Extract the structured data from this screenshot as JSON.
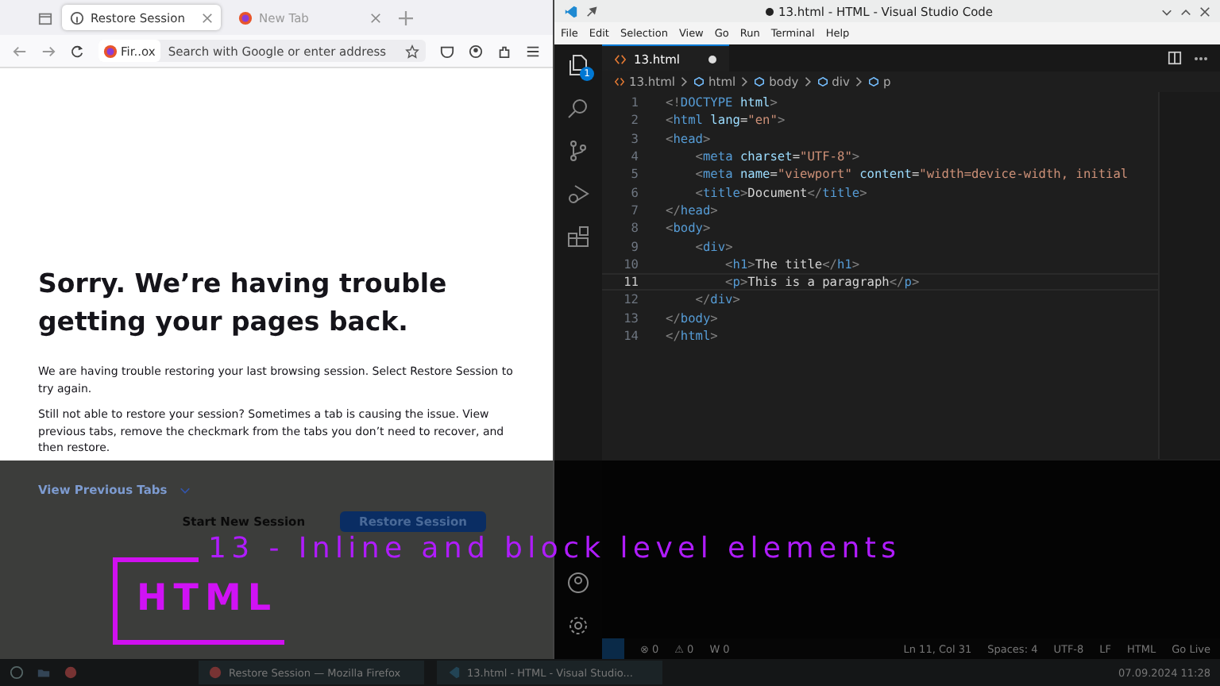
{
  "browser": {
    "tabs": [
      {
        "label": "Restore Session",
        "selected": true,
        "kind": "info"
      },
      {
        "label": "New Tab",
        "selected": false,
        "kind": "firefox"
      }
    ],
    "identity": "Fir..ox",
    "address_placeholder": "Search with Google or enter address",
    "heading": "Sorry. We’re having trouble getting your pages back.",
    "paragraphs": [
      "We are having trouble restoring your last browsing session. Select Restore Session to try again.",
      "Still not able to restore your session? Sometimes a tab is causing the issue. View previous tabs, remove the checkmark from the tabs you don’t need to recover, and then restore."
    ],
    "view_previous": "View Previous Tabs",
    "buttons": [
      {
        "label": "Start New Session",
        "kind": "plain"
      },
      {
        "label": "Restore Session",
        "kind": "primary"
      }
    ]
  },
  "editor": {
    "title": "13.html - HTML - Visual Studio Code",
    "menu": [
      "File",
      "Edit",
      "Selection",
      "View",
      "Go",
      "Run",
      "Terminal",
      "Help"
    ],
    "explorer_badge": "1",
    "tab": {
      "label": "13.html",
      "modified": true
    },
    "breadcrumbs": [
      "13.html",
      "html",
      "body",
      "div",
      "p"
    ],
    "lines": [
      {
        "n": "1",
        "current": false,
        "tokens": [
          {
            "text": "<!",
            "kind": "p"
          },
          {
            "text": "DOCTYPE",
            "kind": "t"
          },
          {
            "text": " html",
            "kind": "a"
          },
          {
            "text": ">",
            "kind": "p"
          }
        ]
      },
      {
        "n": "2",
        "current": false,
        "tokens": [
          {
            "text": "<",
            "kind": "p"
          },
          {
            "text": "html",
            "kind": "t"
          },
          {
            "text": " lang",
            "kind": "a"
          },
          {
            "text": "=",
            "kind": "x"
          },
          {
            "text": "\"en\"",
            "kind": "s"
          },
          {
            "text": ">",
            "kind": "p"
          }
        ]
      },
      {
        "n": "3",
        "current": false,
        "tokens": [
          {
            "text": "<",
            "kind": "p"
          },
          {
            "text": "head",
            "kind": "t"
          },
          {
            "text": ">",
            "kind": "p"
          }
        ]
      },
      {
        "n": "4",
        "current": false,
        "tokens": [
          {
            "text": "    <",
            "kind": "p"
          },
          {
            "text": "meta",
            "kind": "t"
          },
          {
            "text": " charset",
            "kind": "a"
          },
          {
            "text": "=",
            "kind": "x"
          },
          {
            "text": "\"UTF-8\"",
            "kind": "s"
          },
          {
            "text": ">",
            "kind": "p"
          }
        ]
      },
      {
        "n": "5",
        "current": false,
        "tokens": [
          {
            "text": "    <",
            "kind": "p"
          },
          {
            "text": "meta",
            "kind": "t"
          },
          {
            "text": " name",
            "kind": "a"
          },
          {
            "text": "=",
            "kind": "x"
          },
          {
            "text": "\"viewport\"",
            "kind": "s"
          },
          {
            "text": " content",
            "kind": "a"
          },
          {
            "text": "=",
            "kind": "x"
          },
          {
            "text": "\"width=device-width, initial",
            "kind": "s"
          }
        ]
      },
      {
        "n": "6",
        "current": false,
        "tokens": [
          {
            "text": "    <",
            "kind": "p"
          },
          {
            "text": "title",
            "kind": "t"
          },
          {
            "text": ">",
            "kind": "p"
          },
          {
            "text": "Document",
            "kind": "x"
          },
          {
            "text": "</",
            "kind": "p"
          },
          {
            "text": "title",
            "kind": "t"
          },
          {
            "text": ">",
            "kind": "p"
          }
        ]
      },
      {
        "n": "7",
        "current": false,
        "tokens": [
          {
            "text": "</",
            "kind": "p"
          },
          {
            "text": "head",
            "kind": "t"
          },
          {
            "text": ">",
            "kind": "p"
          }
        ]
      },
      {
        "n": "8",
        "current": false,
        "tokens": [
          {
            "text": "<",
            "kind": "p"
          },
          {
            "text": "body",
            "kind": "t"
          },
          {
            "text": ">",
            "kind": "p"
          }
        ]
      },
      {
        "n": "9",
        "current": false,
        "tokens": [
          {
            "text": "    <",
            "kind": "p"
          },
          {
            "text": "div",
            "kind": "t"
          },
          {
            "text": ">",
            "kind": "p"
          }
        ]
      },
      {
        "n": "10",
        "current": false,
        "tokens": [
          {
            "text": "        <",
            "kind": "p"
          },
          {
            "text": "h1",
            "kind": "t"
          },
          {
            "text": ">",
            "kind": "p"
          },
          {
            "text": "The title",
            "kind": "x"
          },
          {
            "text": "</",
            "kind": "p"
          },
          {
            "text": "h1",
            "kind": "t"
          },
          {
            "text": ">",
            "kind": "p"
          }
        ]
      },
      {
        "n": "11",
        "current": true,
        "tokens": [
          {
            "text": "        <",
            "kind": "p"
          },
          {
            "text": "p",
            "kind": "t"
          },
          {
            "text": ">",
            "kind": "p"
          },
          {
            "text": "This is a paragraph",
            "kind": "x"
          },
          {
            "text": "</",
            "kind": "p"
          },
          {
            "text": "p",
            "kind": "t"
          },
          {
            "text": ">",
            "kind": "p"
          }
        ]
      },
      {
        "n": "12",
        "current": false,
        "tokens": [
          {
            "text": "    </",
            "kind": "p"
          },
          {
            "text": "div",
            "kind": "t"
          },
          {
            "text": ">",
            "kind": "p"
          }
        ]
      },
      {
        "n": "13",
        "current": false,
        "tokens": [
          {
            "text": "</",
            "kind": "p"
          },
          {
            "text": "body",
            "kind": "t"
          },
          {
            "text": ">",
            "kind": "p"
          }
        ]
      },
      {
        "n": "14",
        "current": false,
        "tokens": [
          {
            "text": "</",
            "kind": "p"
          },
          {
            "text": "html",
            "kind": "t"
          },
          {
            "text": ">",
            "kind": "p"
          }
        ]
      }
    ],
    "status": {
      "left": [
        "⊗ 0",
        "⚠ 0",
        "W 0"
      ],
      "right": [
        "Ln 11, Col 31",
        "Spaces: 4",
        "UTF-8",
        "LF",
        "HTML",
        "Go Live"
      ]
    }
  },
  "overlay": {
    "title": "13 - Inline and block level elements",
    "logo": "HTML"
  },
  "taskbar": {
    "tasks": [
      {
        "label": "Restore Session — Mozilla Firefox",
        "kind": "firefox"
      },
      {
        "label": "13.html - HTML - Visual Studio...",
        "kind": "vscode"
      }
    ],
    "clock": "07.09.2024 11:28"
  }
}
